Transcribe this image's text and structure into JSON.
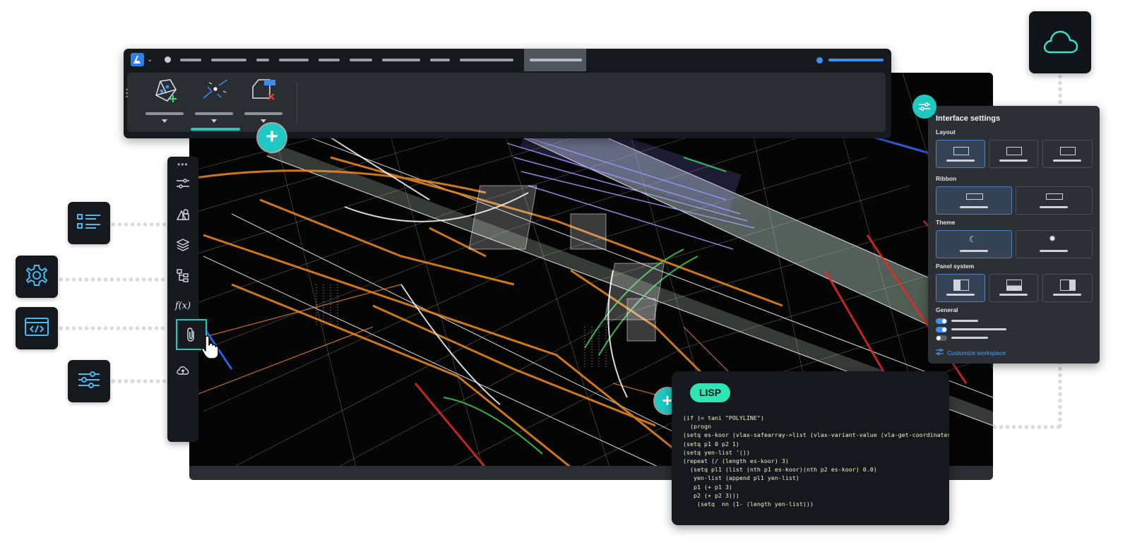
{
  "app": {
    "logo_icon": "bricscad-logo-icon",
    "menu_item_count": 10
  },
  "ribbon": {
    "buttons": [
      {
        "icon": "solid-edit-icon"
      },
      {
        "icon": "snap-point-icon"
      },
      {
        "icon": "delete-face-icon"
      }
    ],
    "active_index": 1
  },
  "toolbar": {
    "icons": [
      "settings-sliders-icon",
      "shapes-icon",
      "layers-icon",
      "hierarchy-icon",
      "function-icon",
      "attach-icon",
      "cloud-upload-icon"
    ],
    "function_label": "f(x)",
    "active_icon": "attach-icon"
  },
  "feature_tiles": [
    "list-icon",
    "gear-icon",
    "code-icon",
    "sliders-icon",
    "cloud-icon"
  ],
  "settings": {
    "title": "Interface settings",
    "sections": {
      "layout": "Layout",
      "ribbon": "Ribbon",
      "theme": "Theme",
      "panel_system": "Panel system",
      "general": "General"
    },
    "theme_icons": [
      "moon-icon",
      "sun-icon"
    ],
    "general_toggles": [
      true,
      true,
      false
    ],
    "customize_label": "Customize workspace"
  },
  "lisp": {
    "badge": "LISP",
    "code": "(if (= tani \"POLYLINE\")\n  (progn\n(setq es-koor (vlax-safearray->list (vlax-variant-value (vla-get-coordinates d\n(setq p1 0 p2 1)\n(setq yen-list '())\n(repeat (/ (length es-koor) 3)\n  (setq pl1 (list (nth p1 es-koor)(nth p2 es-koor) 0.0)\n   yen-list (append pl1 yen-list)\n   p1 (+ p1 3)\n   p2 (+ p2 3)))\n    (setq  nn (1- (length yen-list)))"
  },
  "colors": {
    "accent_teal": "#1fc8c0",
    "lisp_badge": "#2ee6b4",
    "selection_blue": "#3f8ee8"
  }
}
